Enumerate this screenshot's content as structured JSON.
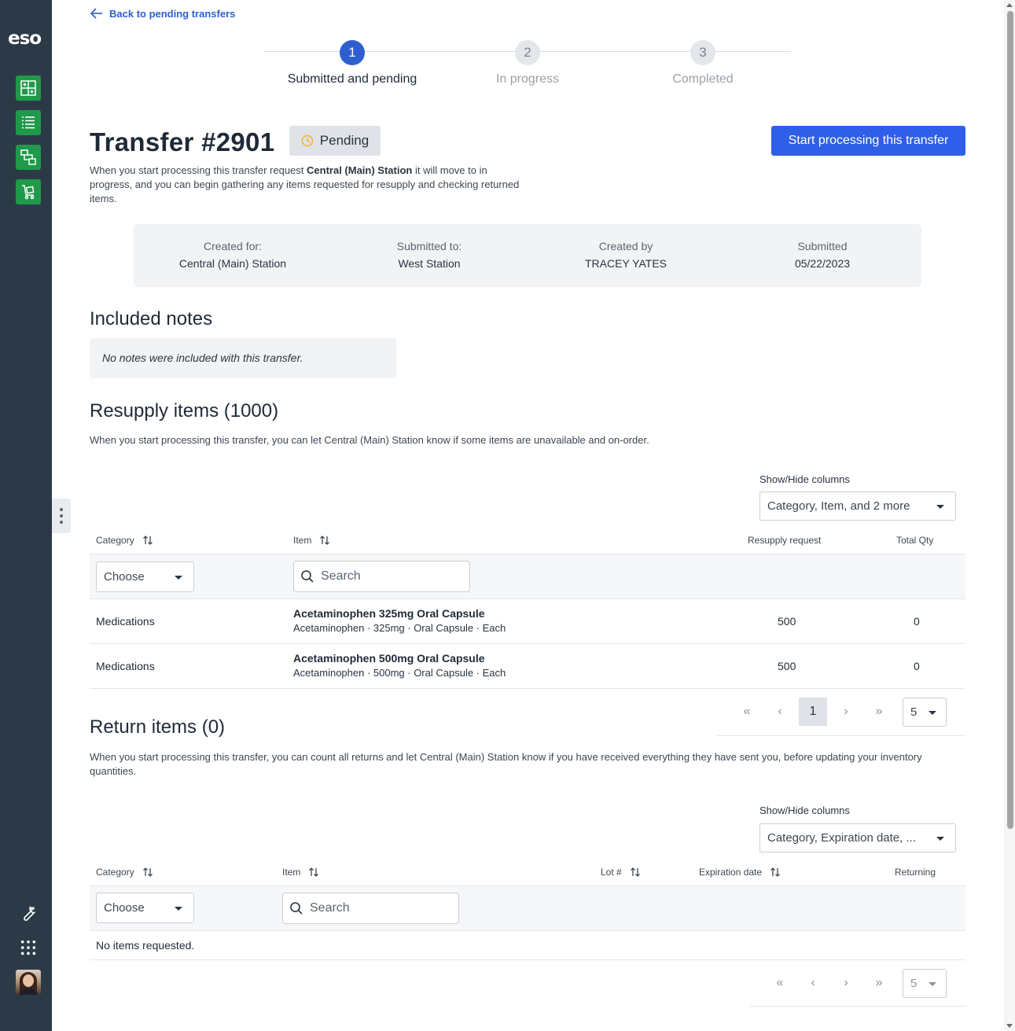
{
  "app": {
    "logo": "eso"
  },
  "back_link": "Back to pending transfers",
  "stepper": [
    {
      "number": "1",
      "label": "Submitted and pending",
      "active": true
    },
    {
      "number": "2",
      "label": "In progress",
      "active": false
    },
    {
      "number": "3",
      "label": "Completed",
      "active": false
    }
  ],
  "transfer": {
    "title": "Transfer #2901",
    "status": "Pending",
    "primary_action": "Start processing this transfer",
    "desc_prefix": "When you start processing this transfer request ",
    "desc_station": "Central (Main) Station",
    "desc_suffix": " it will move to in progress, and you can begin gathering any items requested for resupply and checking returned items."
  },
  "summary": [
    {
      "label": "Created for:",
      "value": "Central (Main) Station"
    },
    {
      "label": "Submitted to:",
      "value": "West Station"
    },
    {
      "label": "Created by",
      "value": "TRACEY YATES"
    },
    {
      "label": "Submitted",
      "value": "05/22/2023"
    }
  ],
  "notes": {
    "heading": "Included notes",
    "empty": "No notes were included with this transfer."
  },
  "resupply": {
    "heading": "Resupply items (1000)",
    "description": "When you start processing this transfer, you can let Central (Main) Station know if some items are unavailable and on-order.",
    "show_hide_label": "Show/Hide columns",
    "show_hide_value": "Category, Item, and 2 more",
    "columns": {
      "category": "Category",
      "item": "Item",
      "resupply": "Resupply request",
      "total": "Total Qty"
    },
    "category_filter": "Choose",
    "item_search_placeholder": "Search",
    "rows": [
      {
        "category": "Medications",
        "name": "Acetaminophen 325mg Oral Capsule",
        "detail": "Acetaminophen · 325mg · Oral Capsule · Each",
        "resupply": "500",
        "total": "0"
      },
      {
        "category": "Medications",
        "name": "Acetaminophen 500mg Oral Capsule",
        "detail": "Acetaminophen · 500mg · Oral Capsule · Each",
        "resupply": "500",
        "total": "0"
      }
    ],
    "pager": {
      "current_page": "1",
      "page_size": "5"
    }
  },
  "returns": {
    "heading": "Return items (0)",
    "description": "When you start processing this transfer, you can count all returns and let Central (Main) Station know if you have received everything they have sent you, before updating your inventory quantities.",
    "show_hide_label": "Show/Hide columns",
    "show_hide_value": "Category, Expiration date, ...",
    "columns": {
      "category": "Category",
      "item": "Item",
      "lot": "Lot #",
      "expiration": "Expiration date",
      "returning": "Returning"
    },
    "category_filter": "Choose",
    "item_search_placeholder": "Search",
    "empty": "No items requested.",
    "pager": {
      "page_size": "5"
    }
  },
  "colors": {
    "sidebar": "#2c3a47",
    "nav_accent": "#1f9a4a",
    "primary": "#2f5fe8",
    "link": "#2f5fcf"
  }
}
